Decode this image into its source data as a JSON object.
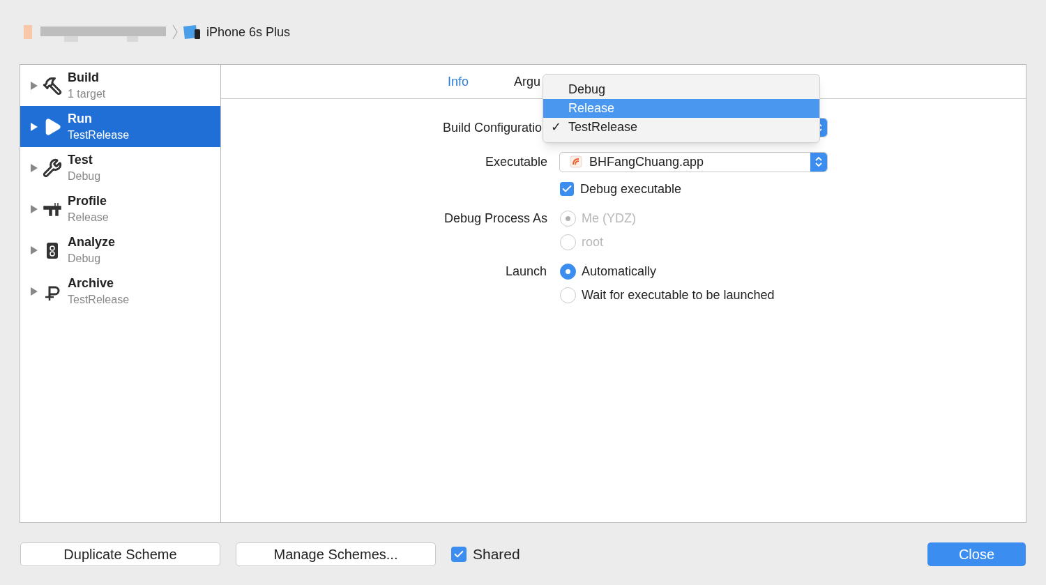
{
  "breadcrumb": {
    "device": "iPhone 6s Plus"
  },
  "sidebar": {
    "items": [
      {
        "kind": "build",
        "title": "Build",
        "subtitle": "1 target",
        "selected": false
      },
      {
        "kind": "run",
        "title": "Run",
        "subtitle": "TestRelease",
        "selected": true
      },
      {
        "kind": "test",
        "title": "Test",
        "subtitle": "Debug",
        "selected": false
      },
      {
        "kind": "profile",
        "title": "Profile",
        "subtitle": "Release",
        "selected": false
      },
      {
        "kind": "analyze",
        "title": "Analyze",
        "subtitle": "Debug",
        "selected": false
      },
      {
        "kind": "archive",
        "title": "Archive",
        "subtitle": "TestRelease",
        "selected": false
      }
    ]
  },
  "tabs": [
    {
      "label": "Info",
      "selected": true
    },
    {
      "label": "Argu",
      "selected": false
    }
  ],
  "form": {
    "build_configuration": {
      "label": "Build Configuratio"
    },
    "executable": {
      "label": "Executable",
      "value": "BHFangChuang.app"
    },
    "debug_executable": {
      "label": "Debug executable",
      "checked": true
    },
    "debug_process_as": {
      "label": "Debug Process As",
      "disabled": true,
      "options": [
        {
          "label": "Me (YDZ)",
          "selected": true
        },
        {
          "label": "root",
          "selected": false
        }
      ]
    },
    "launch": {
      "label": "Launch",
      "disabled": false,
      "options": [
        {
          "label": "Automatically",
          "selected": true
        },
        {
          "label": "Wait for executable to be launched",
          "selected": false
        }
      ]
    }
  },
  "menu": {
    "check": "✓",
    "items": [
      {
        "label": "Debug",
        "selected": false,
        "checked": false
      },
      {
        "label": "Release",
        "selected": true,
        "checked": false
      },
      {
        "label": "TestRelease",
        "selected": false,
        "checked": true
      }
    ]
  },
  "footer": {
    "duplicate": "Duplicate Scheme",
    "manage": "Manage Schemes...",
    "shared": {
      "label": "Shared",
      "checked": true
    },
    "close": "Close"
  }
}
